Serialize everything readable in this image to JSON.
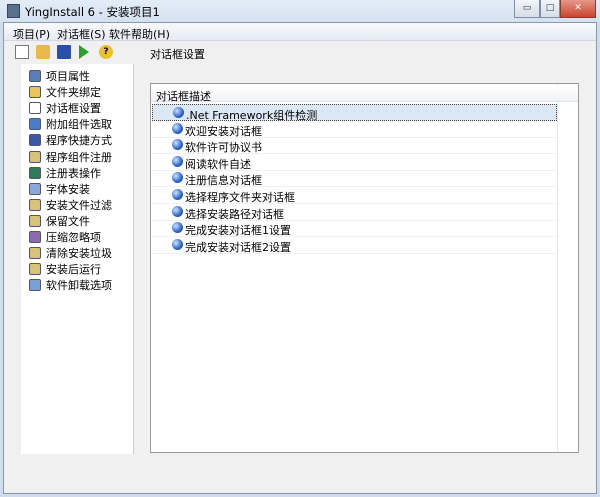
{
  "window": {
    "title": "YingInstall 6 - 安装项目1",
    "minimize": "▭",
    "maximize": "□",
    "close": "✕"
  },
  "menu": [
    "项目(P)",
    "对话框(S)",
    "软件帮助(H)"
  ],
  "toolbar": {
    "label": "对话框设置",
    "buttons": [
      "new-icon",
      "open-icon",
      "save-icon",
      "run-icon",
      "help-icon"
    ]
  },
  "sidebar": {
    "items": [
      {
        "label": "项目属性",
        "color": "#5a7fb8"
      },
      {
        "label": "文件夹绑定",
        "color": "#e8c45a"
      },
      {
        "label": "对话框设置",
        "color": "#ffffff"
      },
      {
        "label": "附加组件选取",
        "color": "#4a7cc8"
      },
      {
        "label": "程序快捷方式",
        "color": "#3a5aa8"
      },
      {
        "label": "程序组件注册",
        "color": "#d9c27a"
      },
      {
        "label": "注册表操作",
        "color": "#2f7a5a"
      },
      {
        "label": "字体安装",
        "color": "#8aa8d8"
      },
      {
        "label": "安装文件过滤",
        "color": "#d9c27a"
      },
      {
        "label": "保留文件",
        "color": "#d9c27a"
      },
      {
        "label": "压缩忽略项",
        "color": "#8a6ab0"
      },
      {
        "label": "清除安装垃圾",
        "color": "#d9c27a"
      },
      {
        "label": "安装后运行",
        "color": "#d9c27a"
      },
      {
        "label": "软件卸载选项",
        "color": "#7aa0d8"
      }
    ]
  },
  "list": {
    "header": "对话框描述",
    "rows": [
      ".Net Framework组件检测",
      "欢迎安装对话框",
      "软件许可协议书",
      "阅读软件自述",
      "注册信息对话框",
      "选择程序文件夹对话框",
      "选择安装路径对话框",
      "完成安装对话框1设置",
      "完成安装对话框2设置"
    ],
    "selected": 0
  }
}
